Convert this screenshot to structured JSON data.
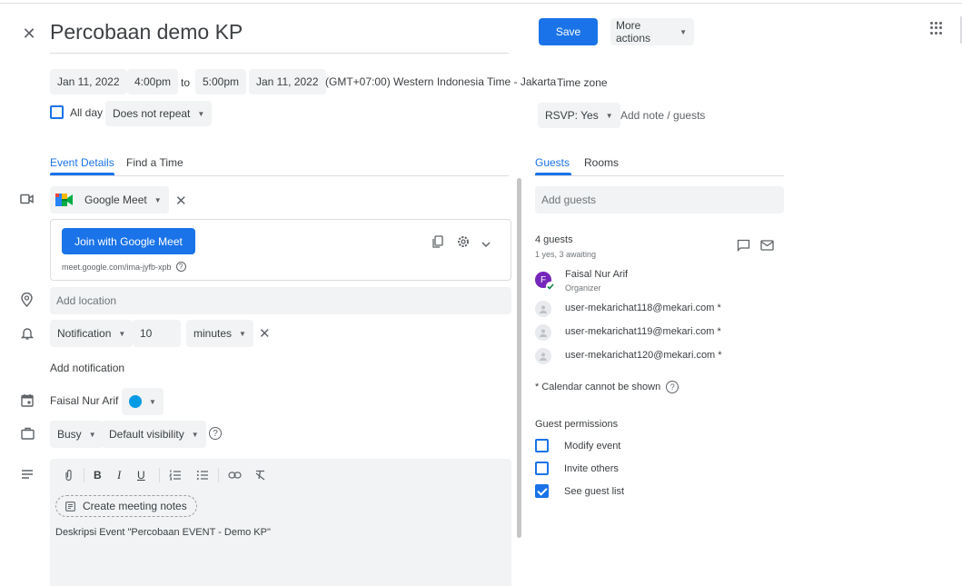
{
  "header": {
    "close_glyph": "✕",
    "title": "Percobaan demo KP",
    "save_label": "Save",
    "more_actions_label": "More actions"
  },
  "datetime": {
    "start_date": "Jan 11, 2022",
    "start_time": "4:00pm",
    "to_label": "to",
    "end_time": "5:00pm",
    "end_date": "Jan 11, 2022",
    "timezone_value": "(GMT+07:00) Western Indonesia Time - Jakarta",
    "timezone_label": "Time zone",
    "all_day_label": "All day",
    "all_day_checked": false,
    "repeat_value": "Does not repeat"
  },
  "rsvp": {
    "value": "RSVP: Yes",
    "add_note_label": "Add note / guests"
  },
  "tabs": [
    {
      "label": "Event Details",
      "active": true
    },
    {
      "label": "Find a Time",
      "active": false
    }
  ],
  "right_tabs": [
    {
      "label": "Guests",
      "active": true
    },
    {
      "label": "Rooms",
      "active": false
    }
  ],
  "conference": {
    "provider_label": "Google Meet",
    "join_label": "Join with Google Meet",
    "link": "meet.google.com/ima-jyfb-xpb"
  },
  "location": {
    "placeholder": "Add location"
  },
  "notification": {
    "type": "Notification",
    "amount": "10",
    "unit": "minutes",
    "add_label": "Add notification"
  },
  "calendar": {
    "owner": "Faisal Nur Arif",
    "color": "#039be5"
  },
  "availability": {
    "busy": "Busy",
    "visibility": "Default visibility"
  },
  "description": {
    "create_notes_label": "Create meeting notes",
    "text": "Deskripsi Event \"Percobaan EVENT - Demo KP\""
  },
  "guests": {
    "add_placeholder": "Add guests",
    "count_label": "4 guests",
    "status_label": "1 yes, 3 awaiting",
    "list": [
      {
        "name": "Faisal Nur Arif",
        "role": "Organizer",
        "initial": "F",
        "avatar_color": "#7627bb"
      },
      {
        "name": "user-mekarichat118@mekari.com *",
        "role": ""
      },
      {
        "name": "user-mekarichat119@mekari.com *",
        "role": ""
      },
      {
        "name": "user-mekarichat120@mekari.com *",
        "role": ""
      }
    ],
    "calendar_note": "* Calendar cannot be shown"
  },
  "permissions": {
    "title": "Guest permissions",
    "items": [
      {
        "label": "Modify event",
        "checked": false
      },
      {
        "label": "Invite others",
        "checked": false
      },
      {
        "label": "See guest list",
        "checked": true
      }
    ]
  },
  "colors": {
    "accent": "#1a73e8",
    "chip_bg": "#f1f3f4",
    "text": "#3c4043",
    "muted": "#70757a"
  }
}
